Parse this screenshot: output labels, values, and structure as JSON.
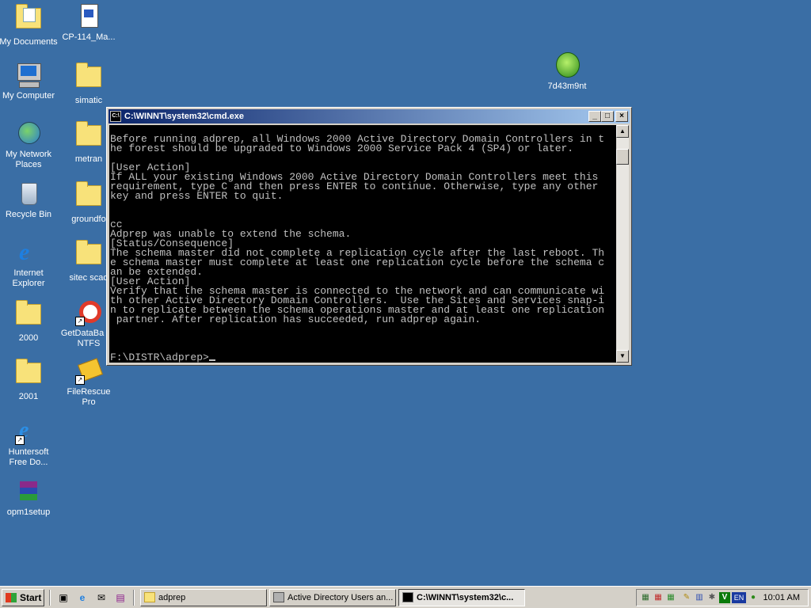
{
  "desktop": {
    "icons": [
      {
        "label": "My Documents"
      },
      {
        "label": "CP-114_Ma..."
      },
      {
        "label": "My Computer"
      },
      {
        "label": "simatic"
      },
      {
        "label": "My Network Places"
      },
      {
        "label": "metran"
      },
      {
        "label": "Recycle Bin"
      },
      {
        "label": "groundfo"
      },
      {
        "label": "Internet Explorer"
      },
      {
        "label": "sitec scad"
      },
      {
        "label": "2000"
      },
      {
        "label": "GetDataBa for NTFS"
      },
      {
        "label": "2001"
      },
      {
        "label": "FileRescue Pro"
      },
      {
        "label": "Huntersoft Free Do..."
      },
      {
        "label": "opm1setup"
      },
      {
        "label": "7d43m9nt"
      }
    ]
  },
  "window": {
    "title": "C:\\WINNT\\system32\\cmd.exe",
    "icon_text": "C:\\",
    "min_glyph": "_",
    "max_glyph": "□",
    "close_glyph": "×",
    "console_lines": [
      "Before running adprep, all Windows 2000 Active Directory Domain Controllers in t",
      "he forest should be upgraded to Windows 2000 Service Pack 4 (SP4) or later.",
      "",
      "[User Action]",
      "If ALL your existing Windows 2000 Active Directory Domain Controllers meet this",
      "requirement, type C and then press ENTER to continue. Otherwise, type any other",
      "key and press ENTER to quit.",
      "",
      "",
      "cc",
      "Adprep was unable to extend the schema.",
      "[Status/Consequence]",
      "The schema master did not complete a replication cycle after the last reboot. Th",
      "e schema master must complete at least one replication cycle before the schema c",
      "an be extended.",
      "[User Action]",
      "Verify that the schema master is connected to the network and can communicate wi",
      "th other Active Directory Domain Controllers.  Use the Sites and Services snap-i",
      "n to replicate between the schema operations master and at least one replication",
      " partner. After replication has succeeded, run adprep again.",
      "",
      "",
      "",
      "F:\\DISTR\\adprep>"
    ],
    "scroll_up": "▲",
    "scroll_down": "▼"
  },
  "taskbar": {
    "start_label": "Start",
    "tasks": [
      {
        "label": "adprep",
        "icon": "folder-icon"
      },
      {
        "label": "Active Directory Users an...",
        "icon": "ad-users-icon"
      },
      {
        "label": "C:\\WINNT\\system32\\c...",
        "icon": "cmd-icon",
        "active": true
      }
    ],
    "tray": {
      "language": "EN",
      "v_badge": "V",
      "clock": "10:01 AM"
    }
  },
  "colors": {
    "desktop": "#3a6ea5",
    "titlebar_start": "#0a246a",
    "titlebar_end": "#a6caf0",
    "console_text": "#c0c0c0",
    "console_bg": "#000000"
  }
}
